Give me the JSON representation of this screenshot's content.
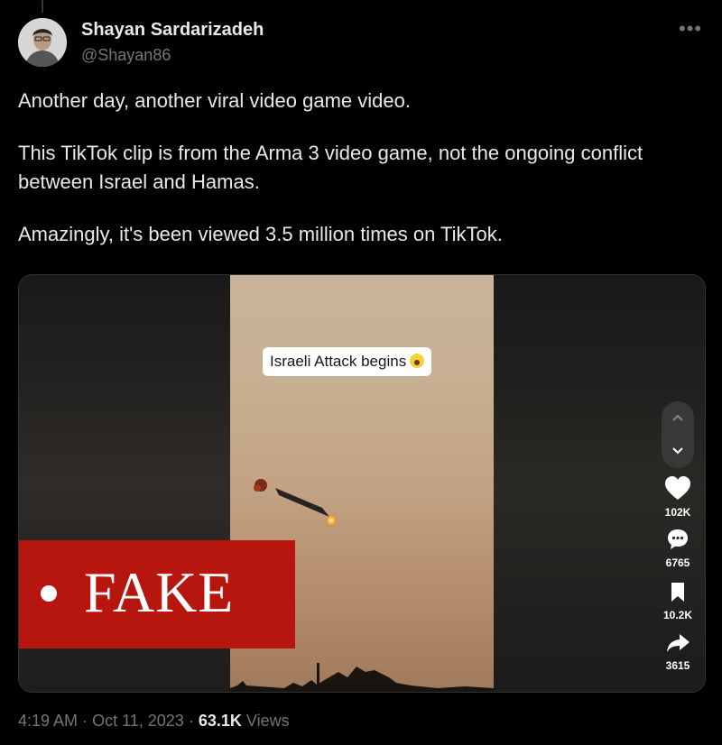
{
  "author": {
    "display_name": "Shayan Sardarizadeh",
    "handle": "@Shayan86"
  },
  "more_icon": "more-horizontal-icon",
  "tweet": {
    "paragraphs": [
      "Another day, another viral video game video.",
      "This TikTok clip is from the Arma 3 video game, not the ongoing conflict between Israel and Hamas.",
      "Amazingly, it's been viewed 3.5 million times on TikTok."
    ]
  },
  "media": {
    "caption": "Israeli Attack begins",
    "caption_emoji": "screaming-face-emoji",
    "fake_label": "FAKE",
    "nav": {
      "up_icon": "chevron-up-icon",
      "down_icon": "chevron-down-icon"
    },
    "actions": [
      {
        "icon": "heart-icon",
        "count": "102K"
      },
      {
        "icon": "comment-icon",
        "count": "6765"
      },
      {
        "icon": "bookmark-icon",
        "count": "10.2K"
      },
      {
        "icon": "share-icon",
        "count": "3615"
      }
    ]
  },
  "meta": {
    "time": "4:19 AM",
    "separator": "·",
    "date": "Oct 11, 2023",
    "views_count": "63.1K",
    "views_label": "Views"
  },
  "colors": {
    "background": "#000000",
    "text_primary": "#e7e9ea",
    "text_secondary": "#71767b",
    "fake_banner": "#b7160f"
  }
}
